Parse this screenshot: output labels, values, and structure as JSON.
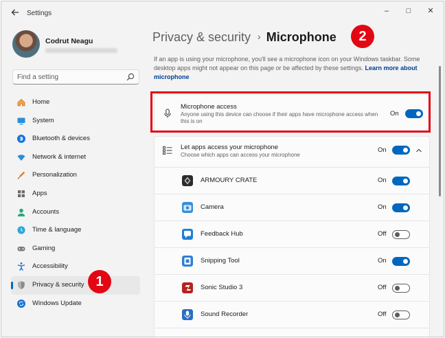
{
  "window": {
    "app_title": "Settings",
    "controls": {
      "minimize": "–",
      "maximize": "□",
      "close": "✕"
    }
  },
  "user": {
    "name": "Codrut Neagu"
  },
  "search": {
    "placeholder": "Find a setting"
  },
  "nav": {
    "items": [
      {
        "label": "Home",
        "icon": "home-icon"
      },
      {
        "label": "System",
        "icon": "system-icon"
      },
      {
        "label": "Bluetooth & devices",
        "icon": "bluetooth-icon"
      },
      {
        "label": "Network & internet",
        "icon": "network-icon"
      },
      {
        "label": "Personalization",
        "icon": "personalization-icon"
      },
      {
        "label": "Apps",
        "icon": "apps-icon"
      },
      {
        "label": "Accounts",
        "icon": "accounts-icon"
      },
      {
        "label": "Time & language",
        "icon": "time-language-icon"
      },
      {
        "label": "Gaming",
        "icon": "gaming-icon"
      },
      {
        "label": "Accessibility",
        "icon": "accessibility-icon"
      },
      {
        "label": "Privacy & security",
        "icon": "privacy-shield-icon",
        "selected": true
      },
      {
        "label": "Windows Update",
        "icon": "windows-update-icon"
      }
    ]
  },
  "breadcrumb": {
    "parent": "Privacy & security",
    "separator": "›",
    "current": "Microphone"
  },
  "description": {
    "text": "If an app is using your microphone, you'll see a microphone icon on your Windows taskbar. Some desktop apps might not appear on this page or be affected by these settings. ",
    "link": "Learn more about microphone"
  },
  "microphone_access": {
    "title": "Microphone access",
    "subtitle": "Anyone using this device can choose if their apps have microphone access when this is on",
    "state": "On",
    "enabled": true
  },
  "let_apps": {
    "title": "Let apps access your microphone",
    "subtitle": "Choose which apps can access your microphone",
    "state": "On",
    "enabled": true
  },
  "apps": [
    {
      "name": "ARMOURY CRATE",
      "state": "On",
      "enabled": true,
      "icon": "armoury-crate-icon"
    },
    {
      "name": "Camera",
      "state": "On",
      "enabled": true,
      "icon": "camera-icon"
    },
    {
      "name": "Feedback Hub",
      "state": "Off",
      "enabled": false,
      "icon": "feedback-hub-icon"
    },
    {
      "name": "Snipping Tool",
      "state": "On",
      "enabled": true,
      "icon": "snipping-tool-icon"
    },
    {
      "name": "Sonic Studio 3",
      "state": "Off",
      "enabled": false,
      "icon": "sonic-studio-icon"
    },
    {
      "name": "Sound Recorder",
      "state": "Off",
      "enabled": false,
      "icon": "sound-recorder-icon"
    }
  ],
  "annotations": {
    "badge_1": "1",
    "badge_2": "2"
  },
  "colors": {
    "accent": "#0067c0",
    "annotation_red": "#e30613"
  }
}
